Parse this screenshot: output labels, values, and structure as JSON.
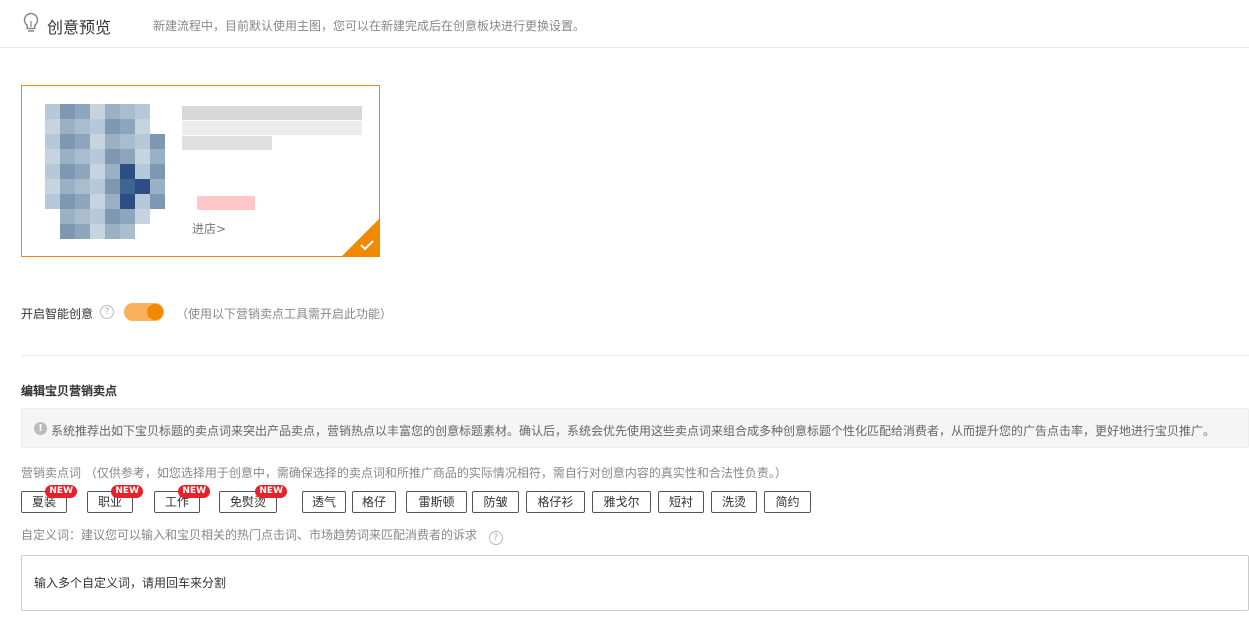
{
  "header": {
    "title": "创意预览",
    "description": "新建流程中，目前默认使用主图，您可以在新建完成后在创意板块进行更换设置。"
  },
  "preview": {
    "shop_link": "进店>"
  },
  "smart_creative": {
    "label": "开启智能创意",
    "enabled": true,
    "hint": "（使用以下营销卖点工具需开启此功能）"
  },
  "selling_points": {
    "title": "编辑宝贝营销卖点",
    "notice": "系统推荐出如下宝贝标题的卖点词来突出产品卖点，营销热点以丰富您的创意标题素材。确认后，系统会优先使用这些卖点词来组合成多种创意标题个性化匹配给消费者，从而提升您的广告点击率，更好地进行宝贝推广。",
    "keywords_label": "营销卖点词 （仅供参考，如您选择用于创意中，需确保选择的卖点词和所推广商品的实际情况相符，需自行对创意内容的真实性和合法性负责。）",
    "tags": [
      {
        "label": "夏装",
        "badge": "NEW"
      },
      {
        "label": "职业",
        "badge": "NEW"
      },
      {
        "label": "工作",
        "badge": "NEW"
      },
      {
        "label": "免熨烫",
        "badge": "NEW"
      },
      {
        "label": "透气",
        "badge": ""
      },
      {
        "label": "格仔",
        "badge": ""
      },
      {
        "label": "雷斯顿",
        "badge": ""
      },
      {
        "label": "防皱",
        "badge": ""
      },
      {
        "label": "格仔衫",
        "badge": ""
      },
      {
        "label": "雅戈尔",
        "badge": ""
      },
      {
        "label": "短衬",
        "badge": ""
      },
      {
        "label": "洗烫",
        "badge": ""
      },
      {
        "label": "简约",
        "badge": ""
      }
    ],
    "custom_label": "自定义词：建议您可以输入和宝贝相关的热门点击词、市场趋势词来匹配消费者的诉求",
    "custom_placeholder": "输入多个自定义词，请用回车来分割"
  },
  "colors": {
    "accent": "#f08a00",
    "badge": "#e8202a"
  },
  "icons": [
    "lightbulb-icon",
    "check-icon",
    "question-icon",
    "info-icon"
  ]
}
